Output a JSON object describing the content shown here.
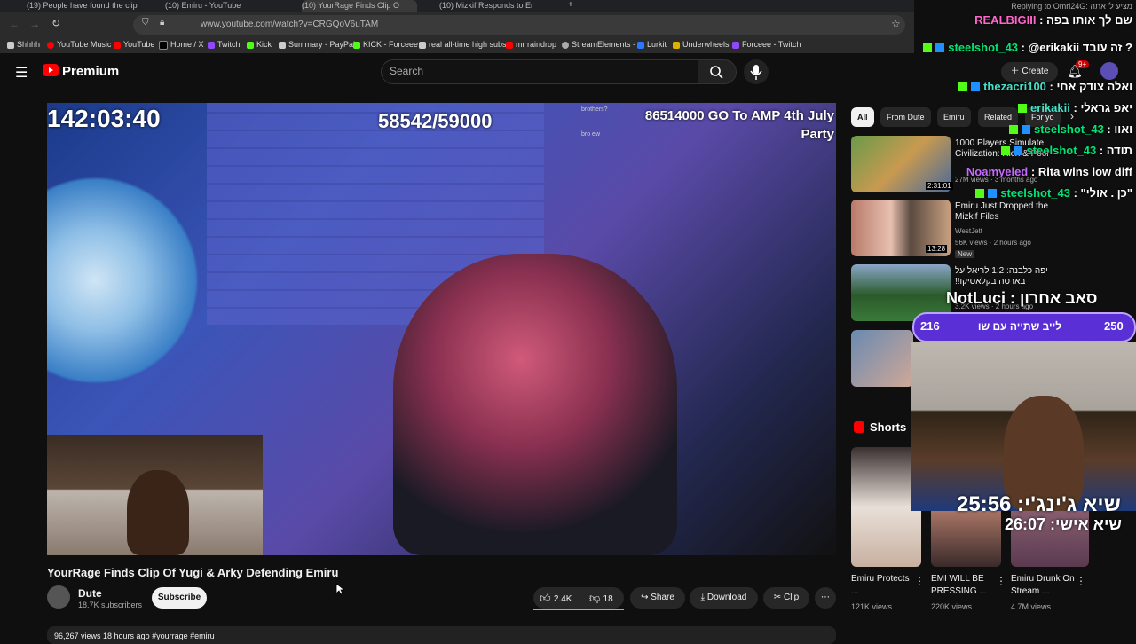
{
  "browser": {
    "tabs": [
      "(19) People have found the clip",
      "(10) Emiru - YouTube",
      "(10) YourRage Finds Clip O",
      "(10) Mizkif Responds to Er"
    ],
    "url": "www.youtube.com/watch?v=CRGQoV6uTAM",
    "bookmarks": [
      "Shhhh",
      "YouTube Music",
      "YouTube",
      "Home / X",
      "Twitch",
      "Kick",
      "Summary - PayPal",
      "KICK - Forceee",
      "real all-time high subs",
      "mr raindrop",
      "StreamElements -",
      "Lurkit",
      "Underwheels",
      "Forceee - Twitch"
    ]
  },
  "youtube": {
    "logo": "Premium",
    "search_placeholder": "Search",
    "create_label": "Create",
    "notifications_badge": "9+",
    "video": {
      "title": "YourRage Finds Clip Of Yugi & Arky Defending Emiru",
      "channel": "Dute",
      "subscribers": "18.7K subscribers",
      "subscribe_label": "Subscribe",
      "likes": "2.4K",
      "dislikes": "18",
      "share_label": "Share",
      "download_label": "Download",
      "clip_label": "Clip",
      "description_meta": "96,267 views  18 hours ago  #yourrage  #emiru",
      "overlay_timer": "142:03:40",
      "overlay_counter": "58542/59000",
      "overlay_goal": "86514000 GO To AMP 4th July Party",
      "overlay_chat": [
        "brothers?",
        "bro ew"
      ]
    },
    "chips": [
      "All",
      "From Dute",
      "Emiru",
      "Related",
      "For yo"
    ],
    "related": [
      {
        "title": "1000 Players Simulate Civilization: Rich & Poor",
        "meta": "27M views · 3 months ago",
        "duration": "2:31:01"
      },
      {
        "title": "Emiru Just Dropped the Mizkif Files",
        "channel": "WestJett",
        "meta": "56K views · 2 hours ago",
        "badge": "New",
        "duration": "13:28"
      },
      {
        "title": "יפה כלבנה: 1:2 לריאל על בארסה בקלאסיקו!!",
        "meta": "3.2K views · 2 hours ago"
      }
    ],
    "shorts_label": "Shorts",
    "shorts": [
      {
        "title": "Emiru Protects ...",
        "views": "121K views"
      },
      {
        "title": "EMI WILL BE PRESSING ...",
        "views": "220K views"
      },
      {
        "title": "Emiru Drunk On Stream ...",
        "views": "4.7M views"
      }
    ]
  },
  "stream_overlay": {
    "replying": "Replying to Omri24G: מציע ל' אתה",
    "chat": [
      {
        "user": "REALBIGIII",
        "text": "שם לך אותו בפה",
        "color": "#ff66cc"
      },
      {
        "user": "steelshot_43",
        "text": "@erikakii זה עובד ?",
        "color": "#00e676"
      },
      {
        "user": "thezacri100",
        "text": "ואלה צודק אחי",
        "color": "#45e0c8"
      },
      {
        "user": "erikakii",
        "text": "יאפ גראלי",
        "color": "#45e0c8"
      },
      {
        "user": "steelshot_43",
        "text": "ואוו",
        "color": "#00e676"
      },
      {
        "user": "steelshot_43",
        "text": "תודה",
        "color": "#00e676"
      },
      {
        "user": "Noamyeled",
        "text": "Rita wins low diff",
        "color": "#c66bff"
      },
      {
        "user": "steelshot_43",
        "text": "\"כן . אולי\"",
        "color": "#00e676"
      }
    ],
    "sub_name": "NotLuci",
    "sub_text": "סאב אחרון",
    "poll_left": "216",
    "poll_right": "250",
    "poll_text": "לייב שתייה עם שו",
    "clock1": "שיא ג'ינג'י: 25:56",
    "clock2": "שיא אישי: 26:07"
  }
}
